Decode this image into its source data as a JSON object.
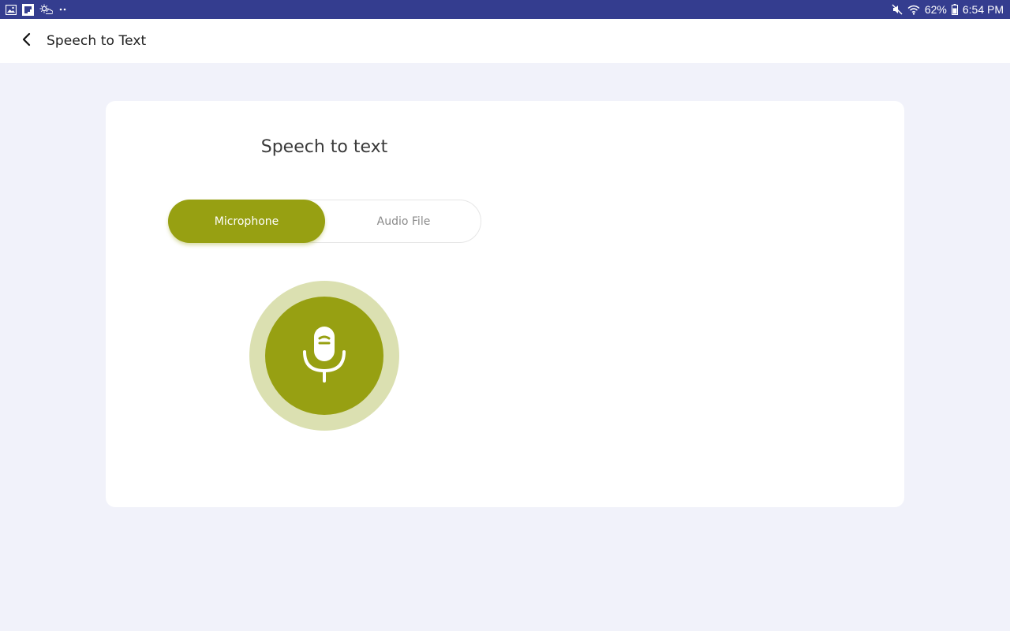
{
  "status_bar": {
    "battery_percent": "62%",
    "time": "6:54 PM",
    "left_icons": [
      "gallery-icon",
      "flipboard-icon",
      "weather-icon",
      "more-notifications-icon"
    ],
    "right_icons": [
      "mute-icon",
      "wifi-icon",
      "battery-icon"
    ]
  },
  "app_bar": {
    "title": "Speech to Text",
    "back_icon": "back-arrow-icon"
  },
  "card": {
    "title": "Speech to text",
    "tabs": [
      {
        "label": "Microphone",
        "active": true
      },
      {
        "label": "Audio File",
        "active": false
      }
    ],
    "mic_button_icon": "microphone-icon"
  },
  "colors": {
    "status_bar": "#343d8f",
    "accent": "#97a012",
    "accent_light": "#dbe0b1",
    "background": "#f1f2fa"
  }
}
